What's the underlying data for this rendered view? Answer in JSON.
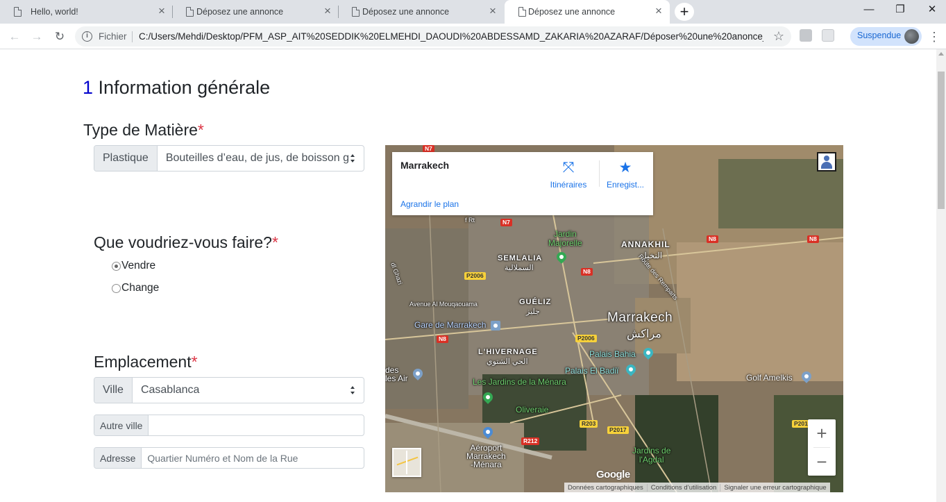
{
  "browser": {
    "tabs": [
      {
        "title": "Hello, world!",
        "active": false
      },
      {
        "title": "Déposez une annonce",
        "active": false
      },
      {
        "title": "Déposez une annonce",
        "active": false
      },
      {
        "title": "Déposez une annonce",
        "active": true
      }
    ],
    "new_tab_glyph": "+",
    "window": {
      "minimize": "—",
      "restore": "❐",
      "close": "✕"
    },
    "nav": {
      "back": "←",
      "forward": "→",
      "reload": "↻"
    },
    "address": {
      "scheme_label": "Fichier",
      "url": "C:/Users/Mehdi/Desktop/PFM_ASP_AIT%20SEDDIK%20ELMEHDI_DAOUDI%20ABDESSAMD_ZAKARIA%20AZARAF/Déposer%20une%20anonce_..."
    },
    "profile_label": "Suspendue",
    "menu_glyph": "⋮",
    "bookmark_glyph": "☆"
  },
  "page": {
    "section_number": "1",
    "section_title": "Information générale",
    "type_matiere": {
      "label": "Type de Matière",
      "required_mark": "*",
      "addon": "Plastique",
      "selected": "Bouteilles d’eau, de jus, de boisson g"
    },
    "action": {
      "label": "Que voudriez-vous faire?",
      "required_mark": "*",
      "options": [
        {
          "label": "Vendre",
          "checked": true
        },
        {
          "label": "Change",
          "checked": false
        }
      ]
    },
    "emplacement": {
      "label": "Emplacement",
      "required_mark": "*",
      "ville_addon": "Ville",
      "ville_selected": "Casablanca",
      "autre_ville_addon": "Autre ville",
      "autre_ville_value": "",
      "adresse_addon": "Adresse",
      "adresse_placeholder": "Quartier Numéro et Nom de la Rue"
    }
  },
  "map": {
    "place_title": "Marrakech",
    "directions_label": "Itinéraires",
    "save_label": "Enregist...",
    "enlarge_label": "Agrandir le plan",
    "zoom_in": "+",
    "zoom_out": "−",
    "google_logo": "Google",
    "attribution": [
      "Données cartographiques",
      "Conditions d’utilisation",
      "Signaler une erreur cartographique"
    ],
    "labels": {
      "annakhil": "ANNAKHIL",
      "annakhil_ar": "النخيل",
      "semlalia": "SEMLALIA",
      "semlalia_ar": "السملالية",
      "jardin_majorelle": "Jardin\nMajorelle",
      "gueliz": "GUÉLIZ",
      "gueliz_ar": "جليز",
      "marrakech": "Marrakech",
      "marrakech_ar": "مراكش",
      "gare": "Gare de Marrakech",
      "hivernage": "L'HIVERNAGE",
      "hivernage_ar": "الحي الشتوي",
      "palais_bahia": "Palais Bahia",
      "palais_badii": "Palais El Badiï",
      "jardins_menara": "Les Jardins de la Ménara",
      "oliveraie": "Oliveraie",
      "golf": "Golf Amelkis",
      "aeroport": "Aéroport\nMarrakech\n-Ménara",
      "jardins_agdal": "Jardins de\nl'Agdal",
      "avenue": "Avenue Al Mouqaouama",
      "route_remparts": "Route des Remparts",
      "cotes": "des\nles Air",
      "f_rt": "f Rt",
      "ghazi": "dl Ghazi"
    },
    "roads": {
      "n7a": "N7",
      "n7b": "N7",
      "n8a": "N8",
      "n8b": "N8",
      "n8c": "N8",
      "n8d": "N8",
      "p2006a": "P2006",
      "p2006b": "P2006",
      "p2017": "P2017",
      "r203": "R203",
      "r212": "R212",
      "p201": "P201"
    }
  }
}
